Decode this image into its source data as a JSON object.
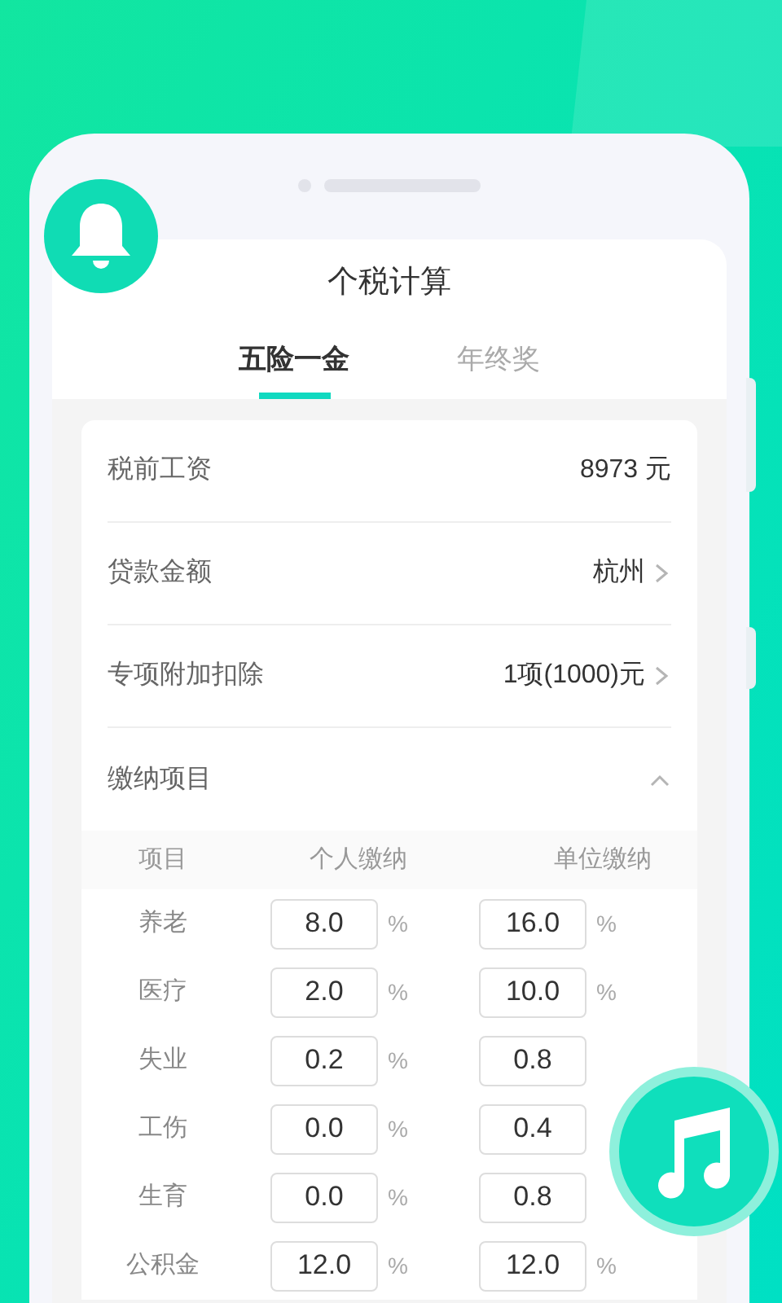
{
  "header": {
    "title": "个税计算"
  },
  "tabs": [
    {
      "label": "五险一金",
      "selected": true
    },
    {
      "label": "年终奖",
      "selected": false
    }
  ],
  "fields": [
    {
      "label": "税前工资",
      "value": "8973 元",
      "chevron": false
    },
    {
      "label": "贷款金额",
      "value": "杭州",
      "chevron": true
    },
    {
      "label": "专项附加扣除",
      "value": "1项(1000)元",
      "chevron": true
    }
  ],
  "section": {
    "label": "缴纳项目",
    "expanded": true
  },
  "table": {
    "columns": [
      "项目",
      "个人缴纳",
      "单位缴纳"
    ],
    "rows": [
      {
        "name": "养老",
        "personal": "8.0",
        "personal_unit": "%",
        "company": "16.0",
        "company_unit": "%"
      },
      {
        "name": "医疗",
        "personal": "2.0",
        "personal_unit": "%",
        "company": "10.0",
        "company_unit": "%"
      },
      {
        "name": "失业",
        "personal": "0.2",
        "personal_unit": "%",
        "company": "0.8"
      },
      {
        "name": "工伤",
        "personal": "0.0",
        "personal_unit": "%",
        "company": "0.4"
      },
      {
        "name": "生育",
        "personal": "0.0",
        "personal_unit": "%",
        "company": "0.8"
      },
      {
        "name": "公积金",
        "personal": "12.0",
        "personal_unit": "%",
        "company": "12.0",
        "company_unit": "%"
      }
    ]
  }
}
